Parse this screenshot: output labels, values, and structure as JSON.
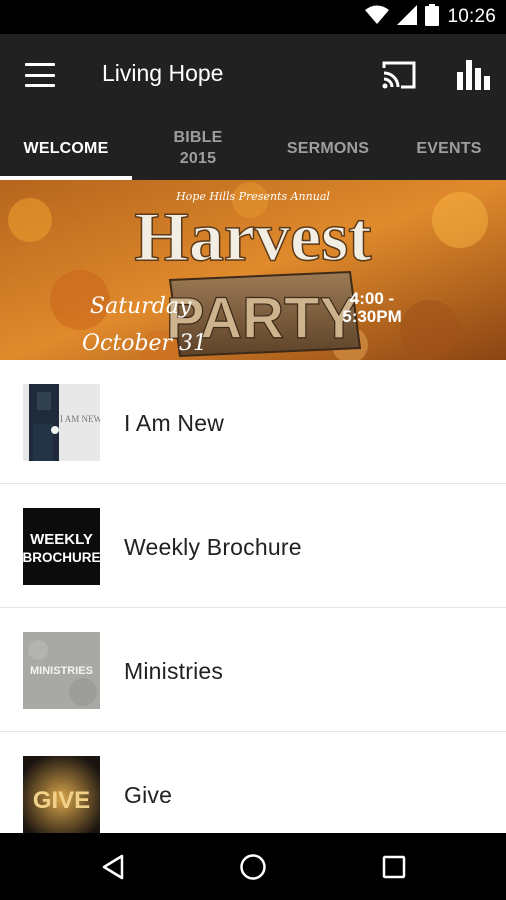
{
  "status_bar": {
    "time": "10:26",
    "icons": [
      "wifi-icon",
      "cellular-signal-icon",
      "battery-icon"
    ]
  },
  "app_bar": {
    "title": "Living Hope",
    "menu_icon": "hamburger-menu-icon",
    "actions": [
      "cast-icon",
      "bar-chart-icon"
    ]
  },
  "tabs": [
    {
      "label": "WELCOME",
      "active": true
    },
    {
      "label": "BIBLE 2015",
      "active": false
    },
    {
      "label": "SERMONS",
      "active": false
    },
    {
      "label": "EVENTS",
      "active": false
    }
  ],
  "banner": {
    "presenter_line": "Hope Hills Presents Annual",
    "title": "Harvest",
    "subtitle": "PARTY",
    "date_line_1": "Saturday",
    "date_line_2": "October 31",
    "time_line_1": "4:00 -",
    "time_line_2": "5:30PM"
  },
  "list": [
    {
      "label": "I Am New",
      "thumb_text": "I AM NEW"
    },
    {
      "label": "Weekly Brochure",
      "thumb_text_1": "WEEKLY",
      "thumb_text_2": "BROCHURE"
    },
    {
      "label": "Ministries",
      "thumb_text": "MINISTRIES"
    },
    {
      "label": "Give",
      "thumb_text": "GIVE"
    }
  ],
  "nav_bar": {
    "buttons": [
      "back-icon",
      "home-icon",
      "recents-icon"
    ]
  },
  "colors": {
    "app_bar": "#212121",
    "status_bar": "#000000",
    "tab_inactive": "#9e9e9e",
    "tab_active": "#ffffff",
    "banner_orange": "#d2691e"
  }
}
